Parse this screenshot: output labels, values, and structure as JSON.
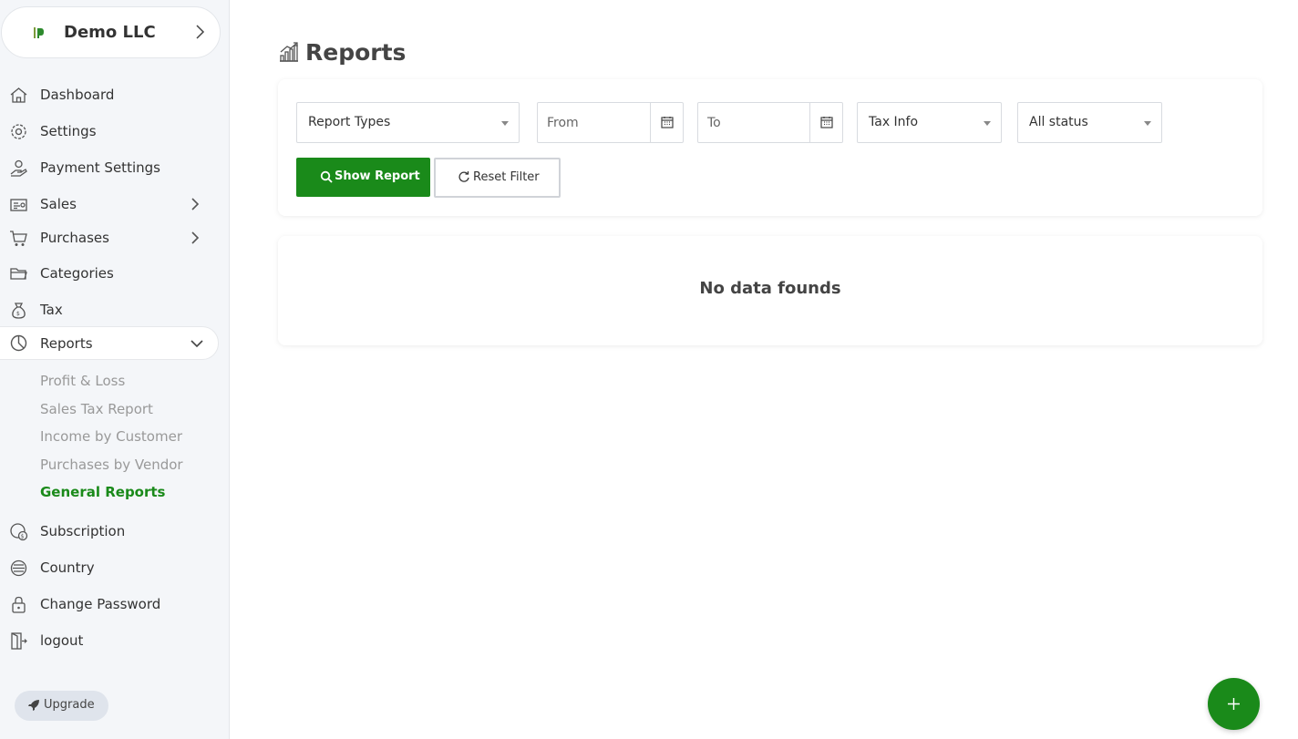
{
  "company": {
    "name": "Demo LLC"
  },
  "sidebar": {
    "items": [
      {
        "label": "Dashboard",
        "icon": "home-icon"
      },
      {
        "label": "Settings",
        "icon": "gear-icon"
      },
      {
        "label": "Payment Settings",
        "icon": "money-hand-icon"
      },
      {
        "label": "Sales",
        "icon": "invoice-icon"
      },
      {
        "label": "Purchases",
        "icon": "cart-icon"
      },
      {
        "label": "Categories",
        "icon": "folder-icon"
      },
      {
        "label": "Tax",
        "icon": "tax-bag-icon"
      },
      {
        "label": "Reports",
        "icon": "pie-chart-icon"
      },
      {
        "label": "Subscription",
        "icon": "subscription-icon"
      },
      {
        "label": "Country",
        "icon": "globe-icon"
      },
      {
        "label": "Change Password",
        "icon": "lock-icon"
      },
      {
        "label": "logout",
        "icon": "logout-icon"
      }
    ],
    "reports_sub": [
      {
        "label": "Profit & Loss"
      },
      {
        "label": "Sales Tax Report"
      },
      {
        "label": "Income by Customer"
      },
      {
        "label": "Purchases by Vendor"
      },
      {
        "label": "General Reports"
      }
    ],
    "upgrade_label": "Upgrade"
  },
  "page": {
    "title": "Reports"
  },
  "filters": {
    "report_type": "Report Types",
    "from_placeholder": "From",
    "to_placeholder": "To",
    "tax_info": "Tax Info",
    "status": "All status",
    "show_label": "Show Report",
    "reset_label": "Reset Filter"
  },
  "results": {
    "empty_message": "No data founds"
  },
  "colors": {
    "primary": "#1a8a1a",
    "sidebar_bg": "#f4f6f9"
  }
}
